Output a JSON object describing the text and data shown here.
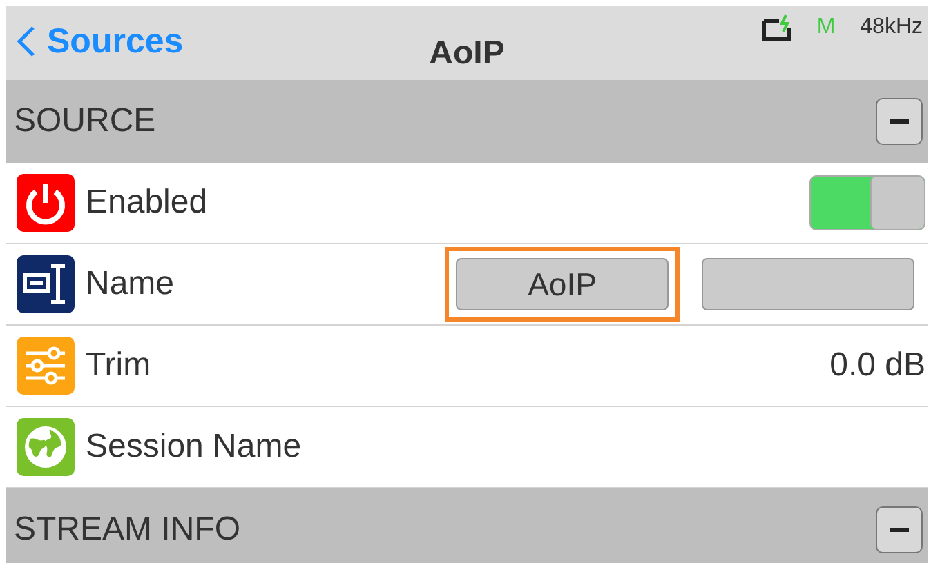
{
  "header": {
    "back_label": "Sources",
    "title": "AoIP",
    "status": {
      "mode": "M",
      "sample_rate": "48kHz"
    }
  },
  "sections": [
    {
      "title": "SOURCE",
      "expanded": true,
      "rows": [
        {
          "kind": "toggle",
          "label": "Enabled",
          "on": true
        },
        {
          "kind": "name",
          "label": "Name",
          "buttons": [
            {
              "label": "AoIP",
              "focused": true
            },
            {
              "focused": false
            }
          ]
        },
        {
          "kind": "trim",
          "label": "Trim",
          "value": "0.0 dB"
        },
        {
          "kind": "session",
          "label": "Session Name"
        }
      ]
    },
    {
      "title": "STREAM INFO",
      "expanded": true
    }
  ]
}
